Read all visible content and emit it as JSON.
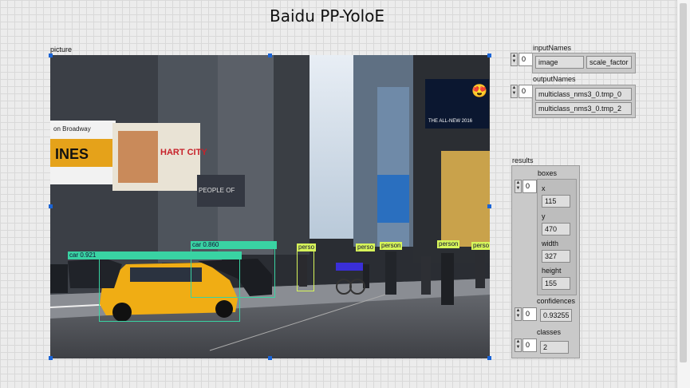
{
  "app_title": "Baidu  PP-YoloE",
  "picture": {
    "label": "picture",
    "scene_text": {
      "billboard_left": "on Broadway",
      "billboard_left2": "INES",
      "hart_sign": "HART CITY",
      "people_sign": "PEOPLE OF",
      "samsung_sign": "THE ALL-NEW 2016"
    },
    "detections": [
      {
        "label": "car 0.921",
        "color": "#39d3a3"
      },
      {
        "label": "car 0.860",
        "color": "#39d3a3"
      },
      {
        "label": "perso",
        "color": "#d7f55a"
      },
      {
        "label": "perso",
        "color": "#d7f55a"
      },
      {
        "label": "person",
        "color": "#d7f55a"
      },
      {
        "label": "person",
        "color": "#d7f55a"
      },
      {
        "label": "perso",
        "color": "#d7f55a"
      },
      {
        "label": "",
        "color": "#3a2fd8"
      }
    ]
  },
  "input_names": {
    "label": "inputNames",
    "index": "0",
    "values": [
      "image",
      "scale_factor"
    ]
  },
  "output_names": {
    "label": "outputNames",
    "index": "0",
    "values": [
      "multiclass_nms3_0.tmp_0",
      "multiclass_nms3_0.tmp_2"
    ]
  },
  "results": {
    "label": "results",
    "index": "0",
    "boxes_label": "boxes",
    "x_label": "x",
    "x": "115",
    "y_label": "y",
    "y": "470",
    "width_label": "width",
    "width": "327",
    "height_label": "height",
    "height": "155",
    "confidences_label": "confidences",
    "confidences_index": "0",
    "confidence": "0.93255",
    "classes_label": "classes",
    "classes_index": "0",
    "class": "2"
  },
  "icons": {
    "spin_up": "▲",
    "spin_down": "▼",
    "emoji": "😍"
  }
}
